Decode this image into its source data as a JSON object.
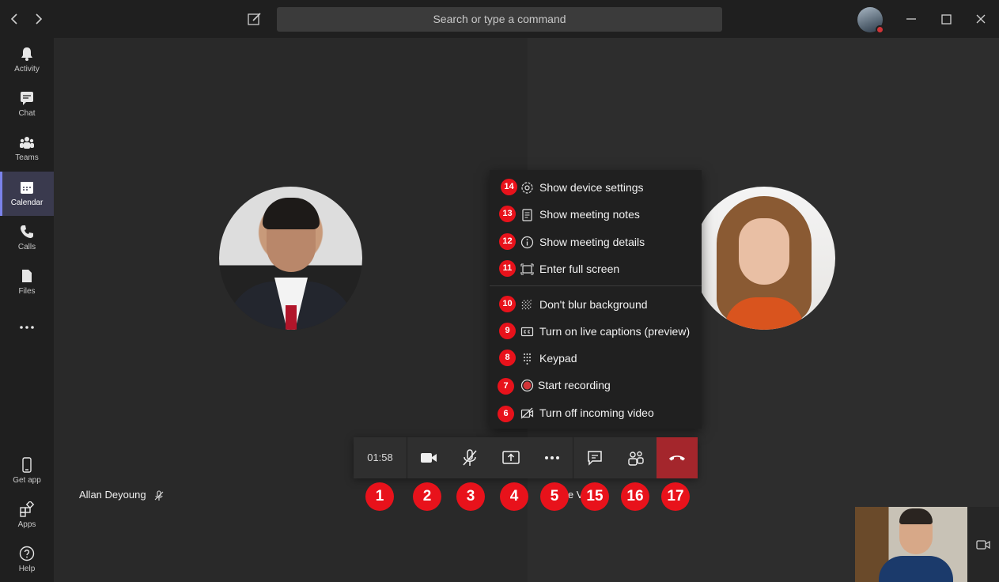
{
  "titlebar": {
    "back_icon": "chevron-left-icon",
    "forward_icon": "chevron-right-icon",
    "compose_icon": "compose-icon",
    "search_placeholder": "Search or type a command",
    "window_controls": [
      "minimize-icon",
      "maximize-icon",
      "close-icon"
    ]
  },
  "sidebar": {
    "items": [
      {
        "label": "Activity",
        "icon": "bell-icon"
      },
      {
        "label": "Chat",
        "icon": "chat-icon"
      },
      {
        "label": "Teams",
        "icon": "teams-icon"
      },
      {
        "label": "Calendar",
        "icon": "calendar-icon",
        "active": true
      },
      {
        "label": "Calls",
        "icon": "phone-icon"
      },
      {
        "label": "Files",
        "icon": "file-icon"
      },
      {
        "label": "",
        "icon": "more-icon"
      }
    ],
    "bottom_items": [
      {
        "label": "Get app",
        "icon": "mobile-icon"
      },
      {
        "label": "Apps",
        "icon": "apps-icon"
      },
      {
        "label": "Help",
        "icon": "help-icon"
      }
    ]
  },
  "participants": [
    {
      "name": "Allan Deyoung",
      "muted": true
    },
    {
      "name": "le V",
      "muted": true
    }
  ],
  "more_menu": {
    "items": [
      {
        "badge": "14",
        "label": "Show device settings",
        "icon": "gear-icon"
      },
      {
        "badge": "13",
        "label": "Show meeting notes",
        "icon": "notes-icon"
      },
      {
        "badge": "12",
        "label": "Show meeting details",
        "icon": "info-icon"
      },
      {
        "badge": "11",
        "label": "Enter full screen",
        "icon": "fullscreen-icon"
      },
      {
        "badge": "10",
        "label": "Don't blur background",
        "icon": "blur-icon"
      },
      {
        "badge": "9",
        "label": "Turn on live captions (preview)",
        "icon": "captions-icon"
      },
      {
        "badge": "8",
        "label": "Keypad",
        "icon": "keypad-icon"
      },
      {
        "badge": "7",
        "label": "Start recording",
        "icon": "record-icon"
      },
      {
        "badge": "6",
        "label": "Turn off incoming video",
        "icon": "video-off-icon"
      }
    ]
  },
  "toolbar": {
    "timer": "01:58",
    "buttons": [
      "camera-icon",
      "mic-off-icon",
      "share-screen-icon",
      "more-options-icon",
      "chat-icon",
      "participants-icon",
      "hang-up-icon"
    ],
    "hangup_color": "#a4262c"
  },
  "callouts": [
    "1",
    "2",
    "3",
    "4",
    "5",
    "15",
    "16",
    "17"
  ],
  "accent": "#e8121b"
}
